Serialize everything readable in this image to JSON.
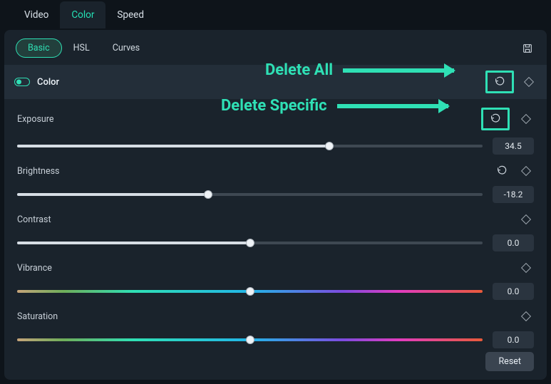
{
  "main_tabs": {
    "video": "Video",
    "color": "Color",
    "speed": "Speed"
  },
  "sub_tabs": {
    "basic": "Basic",
    "hsl": "HSL",
    "curves": "Curves"
  },
  "section": {
    "title": "Color"
  },
  "params": {
    "exposure": {
      "label": "Exposure",
      "value": "34.5",
      "percent": 67
    },
    "brightness": {
      "label": "Brightness",
      "value": "-18.2",
      "percent": 41
    },
    "contrast": {
      "label": "Contrast",
      "value": "0.0",
      "percent": 50
    },
    "vibrance": {
      "label": "Vibrance",
      "value": "0.0",
      "percent": 50
    },
    "saturation": {
      "label": "Saturation",
      "value": "0.0",
      "percent": 50
    }
  },
  "buttons": {
    "reset": "Reset"
  },
  "annotations": {
    "delete_all": "Delete All",
    "delete_specific": "Delete Specific"
  }
}
